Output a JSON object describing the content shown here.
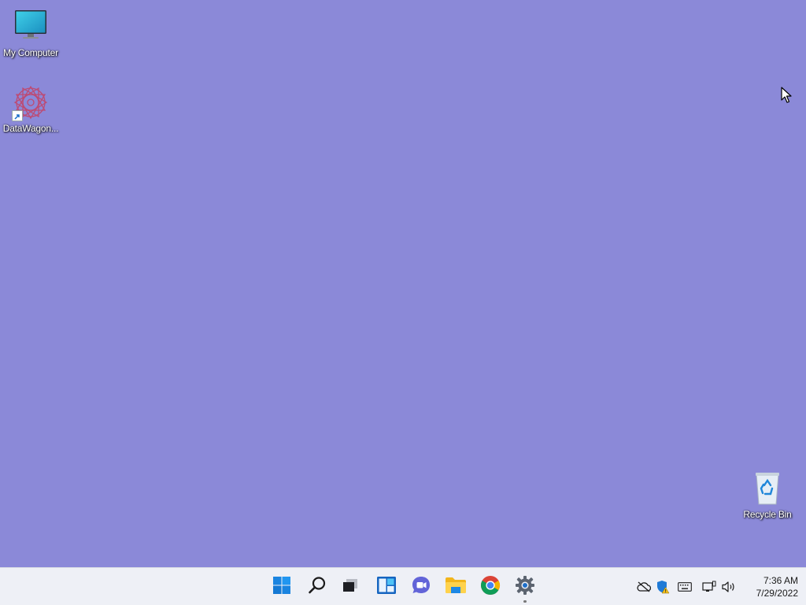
{
  "desktop": {
    "background_color": "#8b89d8",
    "icons": [
      {
        "label": "My Computer",
        "icon": "monitor-icon"
      },
      {
        "label": "DataWagon...",
        "icon": "datawagon-app-icon",
        "shortcut": true
      },
      {
        "label": "Recycle Bin",
        "icon": "recycle-bin-icon"
      }
    ]
  },
  "taskbar": {
    "pinned": [
      {
        "name": "start",
        "icon": "windows-start-icon"
      },
      {
        "name": "search",
        "icon": "search-icon"
      },
      {
        "name": "task-view",
        "icon": "task-view-icon"
      },
      {
        "name": "widgets",
        "icon": "widgets-icon"
      },
      {
        "name": "chat",
        "icon": "chat-icon"
      },
      {
        "name": "file-explorer",
        "icon": "folder-icon"
      },
      {
        "name": "chrome",
        "icon": "chrome-icon"
      },
      {
        "name": "settings",
        "icon": "gear-icon",
        "running": true
      }
    ],
    "tray": [
      {
        "icon": "onedrive-offline-icon"
      },
      {
        "icon": "security-warning-icon"
      },
      {
        "icon": "keyboard-icon"
      },
      {
        "icon": "network-icon"
      },
      {
        "icon": "volume-icon"
      }
    ],
    "clock": {
      "time": "7:36 AM",
      "date": "7/29/2022"
    }
  }
}
